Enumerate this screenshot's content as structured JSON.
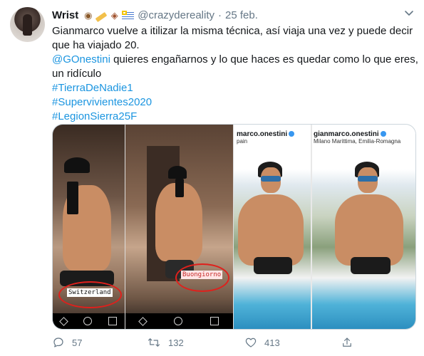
{
  "tweet": {
    "display_name": "Wrist",
    "handle": "@crazydereality",
    "separator": "·",
    "date": "25 feb.",
    "text_lines": [
      "Gianmarco vuelve a itilizar la misma técnica, así viaja una vez y puede decir",
      "que ha viajado 20."
    ],
    "mention": "@GOnestini",
    "mention_rest": " quieres engañarnos y lo que haces es quedar como lo que eres,",
    "text_line_4": "un ridículo",
    "hashtags": [
      "#TierraDeNadie1",
      "#Supervivientes2020",
      "#LegionSierra25F"
    ]
  },
  "media": {
    "panel1_location": "Switzerland",
    "panel2_location": "Buongiorno",
    "panel3_header": "marco.onestini",
    "panel3_sub": "pain",
    "panel4_header": "gianmarco.onestini",
    "panel4_sub": "Milano Marittima, Emilia-Romagna"
  },
  "actions": {
    "replies": "57",
    "retweets": "132",
    "likes": "413"
  },
  "colors": {
    "link": "#1b95e0",
    "secondary_text": "#657786",
    "annotation_circle": "#e0201c"
  },
  "icons": [
    "owl-emoji",
    "pencil-emoji",
    "dog-emoji",
    "uruguay-flag-emoji",
    "chevron-down-icon",
    "reply-icon",
    "retweet-icon",
    "like-icon",
    "share-icon"
  ]
}
